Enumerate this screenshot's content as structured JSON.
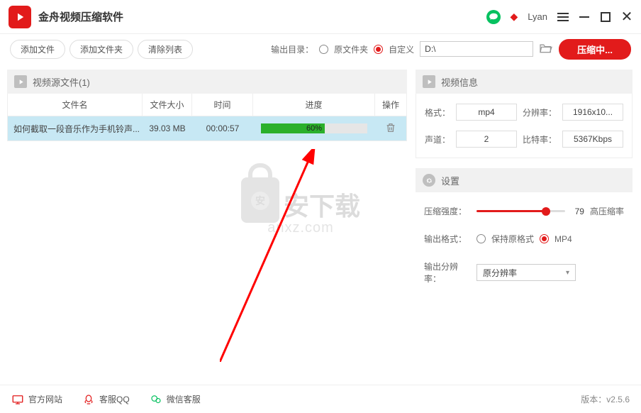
{
  "app": {
    "title": "金舟视频压缩软件",
    "user": "Lyan"
  },
  "toolbar": {
    "add_file": "添加文件",
    "add_folder": "添加文件夹",
    "clear_list": "清除列表",
    "outdir_label": "输出目录：",
    "opt_source": "原文件夹",
    "opt_custom": "自定义",
    "path": "D:\\",
    "compress": "压缩中..."
  },
  "source": {
    "header": "视频源文件(1)",
    "cols": {
      "name": "文件名",
      "size": "文件大小",
      "time": "时间",
      "progress": "进度",
      "op": "操作"
    },
    "rows": [
      {
        "name": "如何截取一段音乐作为手机铃声...",
        "size": "39.03 MB",
        "time": "00:00:57",
        "progress": 60,
        "progress_txt": "60%"
      }
    ]
  },
  "info": {
    "header": "视频信息",
    "format_label": "格式：",
    "format": "mp4",
    "res_label": "分辨率：",
    "res": "1916x10...",
    "channel_label": "声道：",
    "channel": "2",
    "bitrate_label": "比特率：",
    "bitrate": "5367Kbps"
  },
  "settings": {
    "header": "设置",
    "strength_label": "压缩强度：",
    "strength": 79,
    "strength_desc": "高压缩率",
    "outfmt_label": "输出格式：",
    "opt_keep": "保持原格式",
    "opt_mp4": "MP4",
    "outres_label": "输出分辨率：",
    "outres": "原分辨率"
  },
  "footer": {
    "site": "官方网站",
    "qq": "客服QQ",
    "wx": "微信客服",
    "version_label": "版本：",
    "version": "v2.5.6"
  },
  "watermark": {
    "big": "安下载",
    "small": "anxz.com",
    "badge": "安"
  }
}
